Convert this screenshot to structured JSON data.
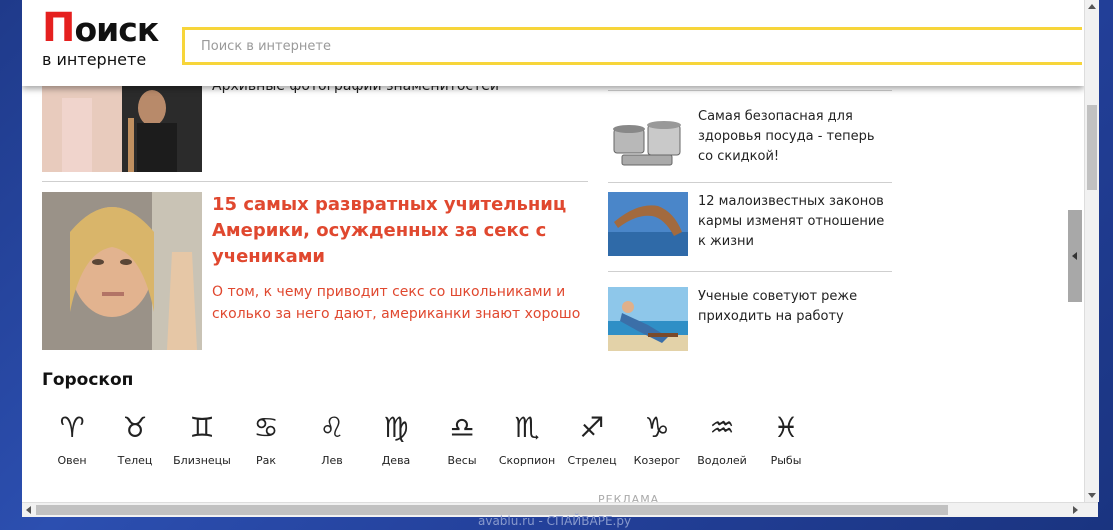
{
  "header": {
    "logo_big": "Поиск",
    "logo_small": "в интернете",
    "search_placeholder": "Поиск в интернете"
  },
  "articles": {
    "top_partial_text": "Архивные фотографии знаменитостей",
    "main": {
      "title": "15 самых развратных учительниц Америки, осужденных за секс с учениками",
      "description": "О том, к чему приводит секс со школьниками и сколько за него дают, американки знают хорошо"
    }
  },
  "sidebar": {
    "items": [
      {
        "text": "Самая безопасная для здоровья посуда - теперь со скидкой!"
      },
      {
        "text": "12 малоизвестных законов кармы изменят отношение к жизни"
      },
      {
        "text": "Ученые советуют реже приходить на работу"
      }
    ]
  },
  "horoscope": {
    "title": "Гороскоп",
    "signs": [
      {
        "glyph": "♈",
        "name": "Овен"
      },
      {
        "glyph": "♉",
        "name": "Телец"
      },
      {
        "glyph": "♊",
        "name": "Близнецы"
      },
      {
        "glyph": "♋",
        "name": "Рак"
      },
      {
        "glyph": "♌",
        "name": "Лев"
      },
      {
        "glyph": "♍",
        "name": "Дева"
      },
      {
        "glyph": "♎",
        "name": "Весы"
      },
      {
        "glyph": "♏",
        "name": "Скорпион"
      },
      {
        "glyph": "♐",
        "name": "Стрелец"
      },
      {
        "glyph": "♑",
        "name": "Козерог"
      },
      {
        "glyph": "♒",
        "name": "Водолей"
      },
      {
        "glyph": "♓",
        "name": "Рыбы"
      }
    ]
  },
  "footer": {
    "ad_label": "РЕКЛАМА",
    "watermark": "avablu.ru - СПАЙВАРЕ.ру"
  },
  "colors": {
    "accent_red": "#e0482f",
    "logo_red": "#e5201f",
    "search_border": "#f7d53a"
  }
}
